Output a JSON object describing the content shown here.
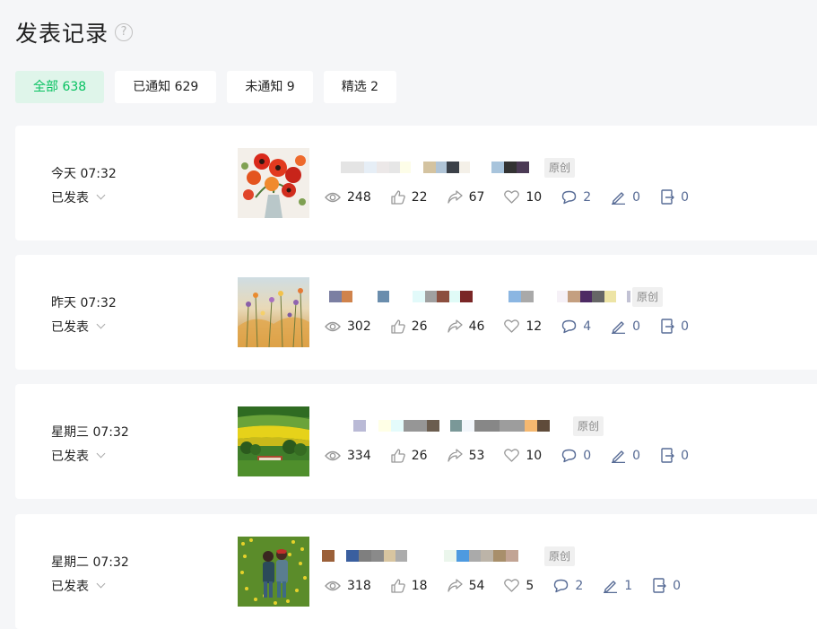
{
  "page": {
    "title": "发表记录",
    "help_glyph": "?"
  },
  "tabs": [
    {
      "label": "全部 638",
      "active": true
    },
    {
      "label": "已通知 629",
      "active": false
    },
    {
      "label": "未通知 9",
      "active": false
    },
    {
      "label": "精选 2",
      "active": false
    }
  ],
  "colors": {
    "accent": "#07c160",
    "tab_active_bg": "#dff5ea",
    "link_blue": "#576b95"
  },
  "records": [
    {
      "time": "今天 07:32",
      "status": "已发表",
      "badge": "原创",
      "thumbnail": "red-poppy-bouquet",
      "stats": {
        "views": "248",
        "likes": "22",
        "shares": "67",
        "wow": "10",
        "comments": "2",
        "notes": "0",
        "forwards": "0"
      }
    },
    {
      "time": "昨天 07:32",
      "status": "已发表",
      "badge": "原创",
      "thumbnail": "wildflower-field",
      "stats": {
        "views": "302",
        "likes": "26",
        "shares": "46",
        "wow": "12",
        "comments": "4",
        "notes": "0",
        "forwards": "0"
      }
    },
    {
      "time": "星期三 07:32",
      "status": "已发表",
      "badge": "原创",
      "thumbnail": "green-yellow-fields-house",
      "stats": {
        "views": "334",
        "likes": "26",
        "shares": "53",
        "wow": "10",
        "comments": "0",
        "notes": "0",
        "forwards": "0"
      }
    },
    {
      "time": "星期二 07:32",
      "status": "已发表",
      "badge": "原创",
      "thumbnail": "two-people-flower-field",
      "stats": {
        "views": "318",
        "likes": "18",
        "shares": "54",
        "wow": "5",
        "comments": "2",
        "notes": "1",
        "forwards": "0"
      }
    }
  ]
}
